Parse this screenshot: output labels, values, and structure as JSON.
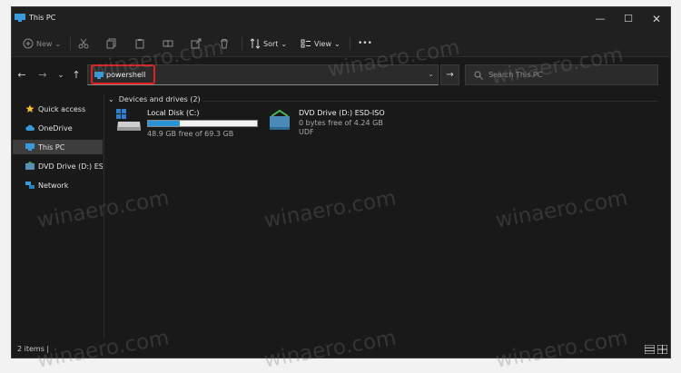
{
  "window": {
    "title": "This PC"
  },
  "toolbar": {
    "new_label": "New",
    "sort_label": "Sort",
    "view_label": "View",
    "more_label": "•••"
  },
  "address_bar": {
    "value": "powershell"
  },
  "search": {
    "placeholder": "Search This PC"
  },
  "sidebar": {
    "items": [
      {
        "label": "Quick access",
        "icon": "star-icon"
      },
      {
        "label": "OneDrive",
        "icon": "cloud-icon"
      },
      {
        "label": "This PC",
        "icon": "monitor-icon"
      },
      {
        "label": "DVD Drive (D:) ESD-I",
        "icon": "dvd-icon"
      },
      {
        "label": "Network",
        "icon": "network-icon"
      }
    ]
  },
  "content": {
    "group_label": "Devices and drives (2)",
    "drives": [
      {
        "name": "Local Disk (C:)",
        "free_text": "48.9 GB free of 69.3 GB",
        "used_fraction": 0.29,
        "icon": "hard-drive-icon"
      },
      {
        "name": "DVD Drive (D:) ESD-ISO",
        "free_text": "0 bytes free of 4.24 GB",
        "filesystem": "UDF",
        "icon": "dvd-drive-icon"
      }
    ]
  },
  "status": {
    "items_text": "2 items  |"
  },
  "watermark": "winaero.com",
  "colors": {
    "accent": "#2a93d5",
    "highlight": "#e02020",
    "background": "#191919"
  }
}
